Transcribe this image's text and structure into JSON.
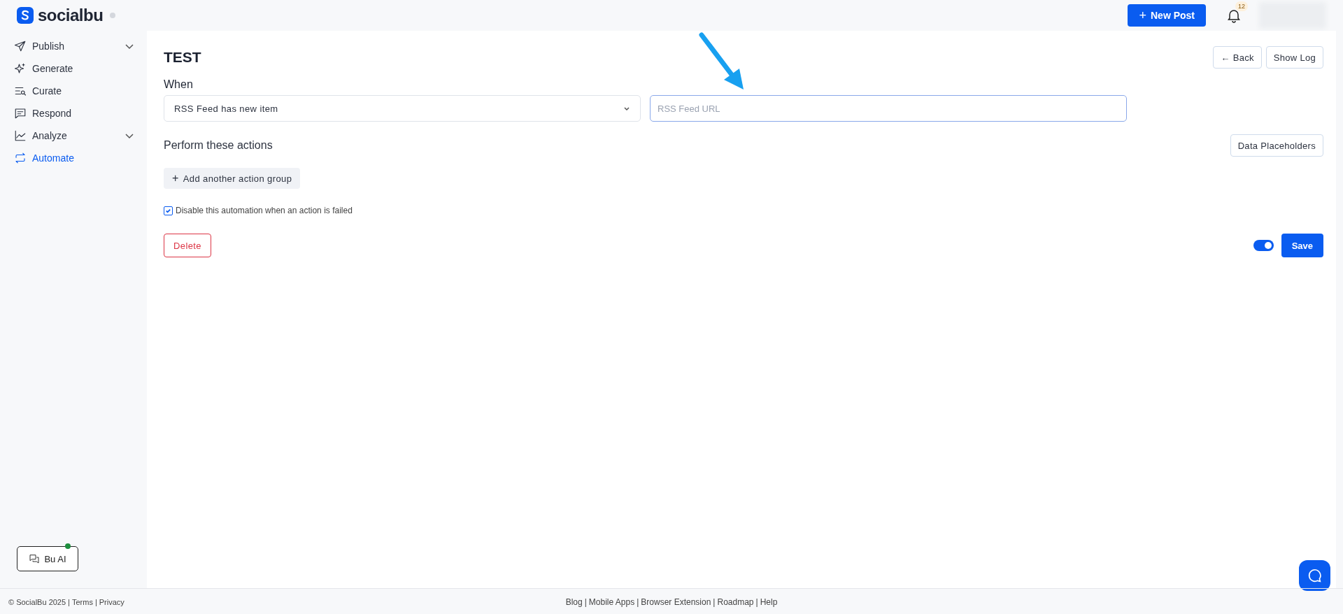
{
  "brand": {
    "name": "socialbu"
  },
  "header": {
    "new_post": "New Post",
    "plus": "+",
    "notification_count": "12"
  },
  "sidebar": {
    "items": [
      {
        "label": "Publish",
        "kind": "send",
        "expandable": true,
        "selected": false
      },
      {
        "label": "Generate",
        "kind": "sparkle",
        "expandable": false,
        "selected": false
      },
      {
        "label": "Curate",
        "kind": "curate",
        "expandable": false,
        "selected": false
      },
      {
        "label": "Respond",
        "kind": "chat",
        "expandable": false,
        "selected": false
      },
      {
        "label": "Analyze",
        "kind": "chart",
        "expandable": true,
        "selected": false
      },
      {
        "label": "Automate",
        "kind": "repeat",
        "expandable": false,
        "selected": true
      }
    ],
    "bu_ai": {
      "label": "Bu AI",
      "online": true
    }
  },
  "page": {
    "title": "TEST",
    "back": "Back",
    "back_arrow": "←",
    "show_log": "Show Log",
    "when_label": "When",
    "trigger": "RSS Feed has new item",
    "url_placeholder": "RSS Feed URL",
    "actions_heading": "Perform these actions",
    "data_placeholders": "Data Placeholders",
    "add_group": "Add another action group",
    "add_plus": "+",
    "disable_option": {
      "label": "Disable this automation when an action is failed",
      "checked": true
    },
    "delete": "Delete",
    "active_toggle": {
      "on": true
    },
    "save": "Save"
  },
  "footer": {
    "separator": "|",
    "left": [
      "© SocialBu 2025",
      "Terms",
      "Privacy"
    ],
    "links": [
      "Blog",
      "Mobile Apps",
      "Browser Extension",
      "Roadmap",
      "Help"
    ]
  }
}
